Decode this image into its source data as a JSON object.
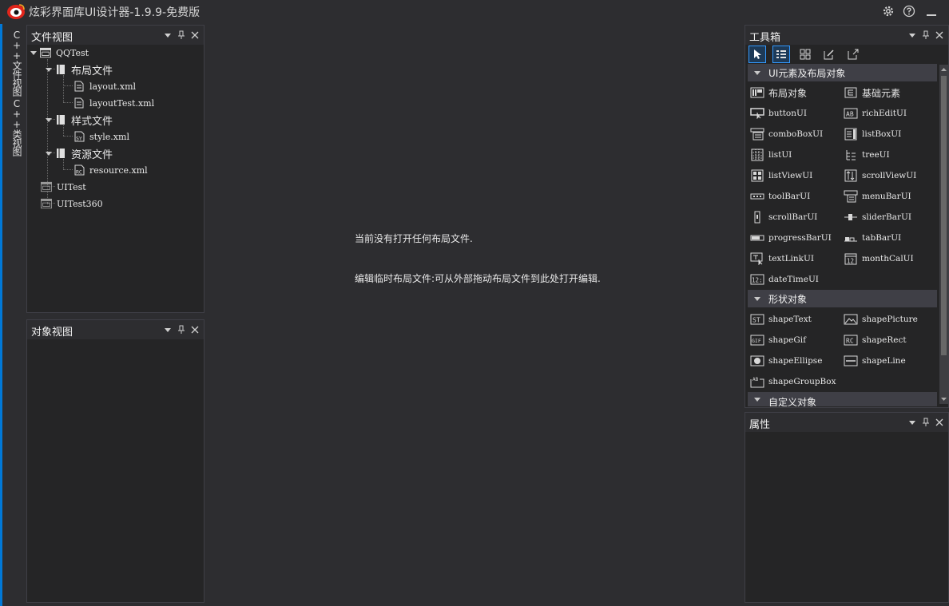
{
  "window": {
    "title": "炫彩界面库UI设计器-1.9.9-免费版"
  },
  "left_strip": {
    "tabs": [
      {
        "label": "C++文件视图"
      },
      {
        "label": "C++类视图"
      }
    ]
  },
  "file_view": {
    "title": "文件视图",
    "tree": [
      {
        "label": "QQTest"
      },
      {
        "label": "布局文件"
      },
      {
        "label": "layout.xml"
      },
      {
        "label": "layoutTest.xml"
      },
      {
        "label": "样式文件"
      },
      {
        "label": "style.xml"
      },
      {
        "label": "资源文件"
      },
      {
        "label": "resource.xml"
      },
      {
        "label": "UITest"
      },
      {
        "label": "UITest360"
      }
    ]
  },
  "object_view": {
    "title": "对象视图"
  },
  "editor": {
    "line1": "当前没有打开任何布局文件.",
    "line2": "编辑临时布局文件:可从外部拖动布局文件到此处打开编辑."
  },
  "toolbox": {
    "title": "工具箱",
    "groups": [
      {
        "title": "UI元素及布局对象"
      },
      {
        "title": "形状对象"
      },
      {
        "title": "自定义对象"
      }
    ],
    "items": [
      {
        "label": "布局对象",
        "icon": "layout-icon"
      },
      {
        "label": "基础元素",
        "icon": "element-icon"
      },
      {
        "label": "buttonUI",
        "icon": "button-icon"
      },
      {
        "label": "richEditUI",
        "icon": "richedit-icon"
      },
      {
        "label": "comboBoxUI",
        "icon": "combobox-icon"
      },
      {
        "label": "listBoxUI",
        "icon": "listbox-icon"
      },
      {
        "label": "listUI",
        "icon": "list-icon"
      },
      {
        "label": "treeUI",
        "icon": "tree-icon"
      },
      {
        "label": "listViewUI",
        "icon": "listview-icon"
      },
      {
        "label": "scrollViewUI",
        "icon": "scrollview-icon"
      },
      {
        "label": "toolBarUI",
        "icon": "toolbar-icon"
      },
      {
        "label": "menuBarUI",
        "icon": "menubar-icon"
      },
      {
        "label": "scrollBarUI",
        "icon": "scrollbar-icon"
      },
      {
        "label": "sliderBarUI",
        "icon": "sliderbar-icon"
      },
      {
        "label": "progressBarUI",
        "icon": "progressbar-icon"
      },
      {
        "label": "tabBarUI",
        "icon": "tabbar-icon"
      },
      {
        "label": "textLinkUI",
        "icon": "textlink-icon"
      },
      {
        "label": "monthCalUI",
        "icon": "monthcal-icon"
      },
      {
        "label": "dateTimeUI",
        "icon": "datetime-icon"
      },
      {
        "label": "shapeText",
        "icon": "shape-text-icon"
      },
      {
        "label": "shapePicture",
        "icon": "shape-picture-icon"
      },
      {
        "label": "shapeGif",
        "icon": "shape-gif-icon"
      },
      {
        "label": "shapeRect",
        "icon": "shape-rect-icon"
      },
      {
        "label": "shapeEllipse",
        "icon": "shape-ellipse-icon"
      },
      {
        "label": "shapeLine",
        "icon": "shape-line-icon"
      },
      {
        "label": "shapeGroupBox",
        "icon": "shape-groupbox-icon"
      }
    ],
    "icon_text": {
      "richedit": "AB",
      "monthcal": "12",
      "datetime": "12:",
      "shape_text": "ST",
      "shape_gif": "GIF",
      "shape_rect": "RC",
      "groupbox": "AB",
      "resource": "RC",
      "style": "SY"
    }
  },
  "properties": {
    "title": "属性"
  },
  "colors": {
    "background": "#2d2d30",
    "panel": "#252526",
    "accent": "#3399ff",
    "logo_red": "#e1251b"
  }
}
